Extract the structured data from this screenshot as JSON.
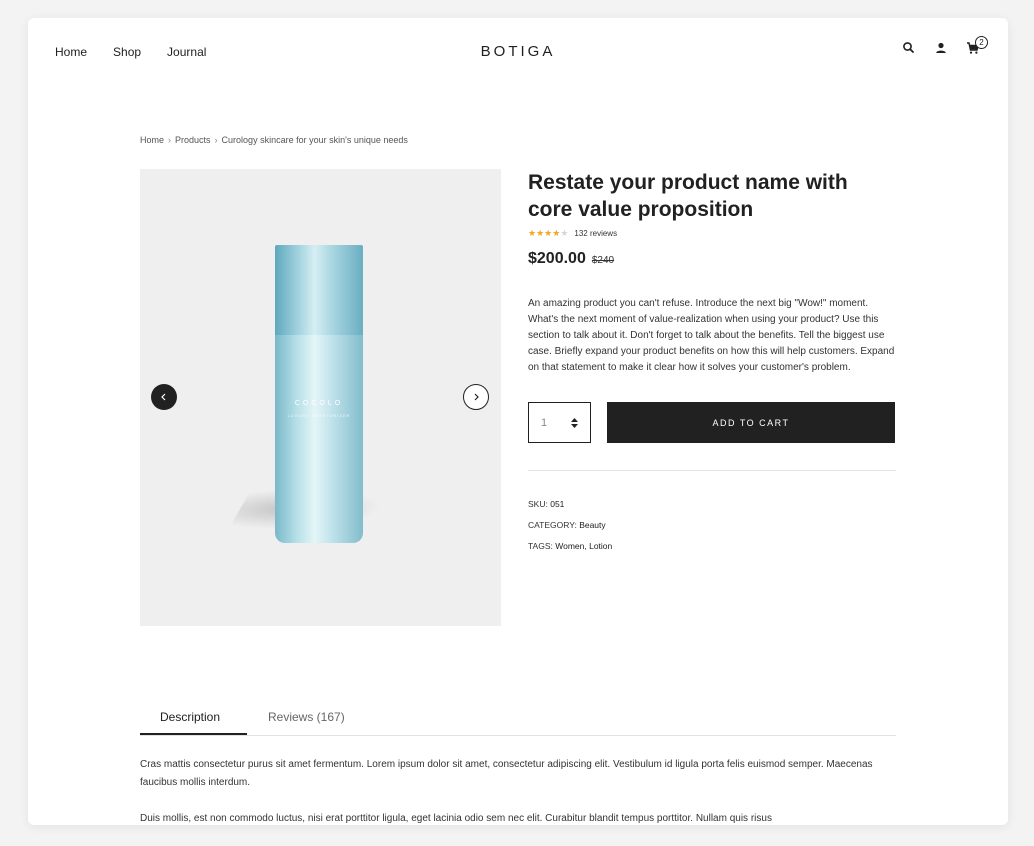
{
  "header": {
    "nav": [
      "Home",
      "Shop",
      "Journal"
    ],
    "logo": "BOTIGA",
    "cart_count": "2",
    "icons": [
      "search-icon",
      "user-icon",
      "cart-icon"
    ]
  },
  "breadcrumb": [
    "Home",
    "Products",
    "Curology skincare for your skin's unique needs"
  ],
  "product": {
    "title": "Restate your product name with core value proposition",
    "rating": 4,
    "rating_max": 5,
    "reviews_label": "132 reviews",
    "price": "$200.00",
    "old_price": "$240",
    "description": "An amazing product you can't refuse. Introduce the next big \"Wow!\" moment. What's the next moment of value-realization when using your product? Use this section to talk about it. Don't forget to talk about the benefits. Tell the biggest use case. Briefly expand your product benefits on how this will help customers. Expand on that statement to make it clear how it solves your customer's problem.",
    "quantity": "1",
    "add_to_cart": "ADD TO CART",
    "sku_label": "SKU:",
    "sku": "051",
    "category_label": "CATEGORY:",
    "category": "Beauty",
    "tags_label": "TAGS:",
    "tags": "Women, Lotion",
    "bottle_brand": "COCOLO",
    "bottle_sub": "LUXURY MOISTURIZER"
  },
  "tabs": {
    "description": "Description",
    "reviews": "Reviews (167)"
  },
  "content": {
    "para1": "Cras mattis consectetur purus sit amet fermentum. Lorem ipsum dolor sit amet, consectetur adipiscing elit. Vestibulum id ligula porta felis euismod semper. Maecenas faucibus mollis interdum.",
    "para2": "Duis mollis, est non commodo luctus, nisi erat porttitor ligula, eget lacinia odio sem nec elit. Curabitur blandit tempus porttitor. Nullam quis risus"
  },
  "colors": {
    "accent": "#212121",
    "star": "#f5a623",
    "star_empty": "#d6d6d6",
    "gallery_bg": "#efefef"
  }
}
